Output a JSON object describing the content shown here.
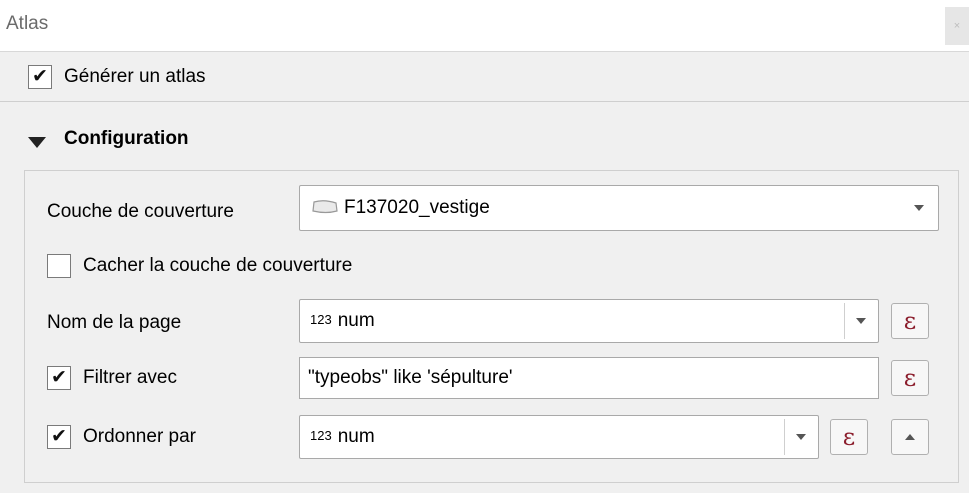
{
  "window": {
    "title": "Atlas",
    "close_glyph": "×"
  },
  "generate_atlas": {
    "label": "Générer un atlas",
    "checked": true
  },
  "configuration": {
    "header": "Configuration",
    "coverage_layer": {
      "label": "Couche de couverture",
      "value": "F137020_vestige",
      "icon": "polygon-layer-icon"
    },
    "hide_coverage": {
      "label": "Cacher la couche de couverture",
      "checked": false
    },
    "page_name": {
      "label": "Nom de la page",
      "type_prefix": "123",
      "value": "num"
    },
    "filter_with": {
      "label": "Filtrer avec",
      "checked": true,
      "value": "\"typeobs\" like  'sépulture'"
    },
    "sort_by": {
      "label": "Ordonner par",
      "checked": true,
      "type_prefix": "123",
      "value": "num"
    },
    "expression_glyph": "ε",
    "check_glyph": "✔"
  },
  "colors": {
    "expression_icon": "#8b1d2c",
    "background": "#f0f0f0"
  }
}
